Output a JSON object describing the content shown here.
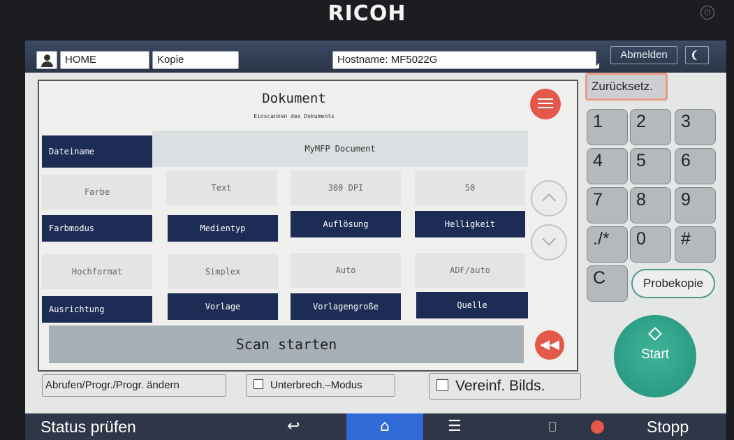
{
  "device": {
    "brand": "RICOH"
  },
  "topbar": {
    "home": "HOME",
    "app": "Kopie",
    "hostname": "Hostname: MF5022G",
    "logout": "Abmelden"
  },
  "panel": {
    "title": "Dokument",
    "subtitle": "Einscannen des Dokuments",
    "filename_label": "Dateiname",
    "filename_value": "MyMFP Document",
    "row1": [
      {
        "value": "Farbe",
        "label": "Farbmodus"
      },
      {
        "value": "Text",
        "label": "Medientyp"
      },
      {
        "value": "300 DPI",
        "label": "Auflösung"
      },
      {
        "value": "50",
        "label": "Helligkeit"
      }
    ],
    "row2": [
      {
        "value": "Hochformat",
        "label": "Ausrichtung"
      },
      {
        "value": "Simplex",
        "label": "Vorlage"
      },
      {
        "value": "Auto",
        "label": "Vorlagengroße"
      },
      {
        "value": "ADF/auto",
        "label": "Quelle"
      }
    ],
    "scan_button": "Scan starten"
  },
  "bottom": {
    "recall": "Abrufen/Progr./Progr. ändern",
    "interrupt": "Unterbrech.–Modus",
    "simple": "Vereinf. Bilds."
  },
  "keypad": {
    "reset": "Zurücksetz.",
    "keys": [
      "1",
      "2",
      "3",
      "4",
      "5",
      "6",
      "7",
      "8",
      "9",
      "./*",
      "0",
      "#",
      "C"
    ],
    "trial": "Probekopie",
    "start": "Start"
  },
  "statusbar": {
    "status": "Status prüfen",
    "stop": "Stopp"
  },
  "colors": {
    "accent_red": "#e4574b",
    "navy": "#1c2c54",
    "start_green": "#2aa189",
    "home_blue": "#2f6ad6"
  }
}
